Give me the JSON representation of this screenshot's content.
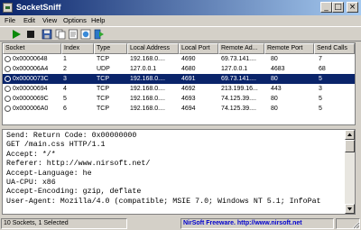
{
  "window": {
    "title": "SocketSniff",
    "minimize_glyph": "_",
    "maximize_glyph": "□",
    "close_glyph": "×"
  },
  "menu": [
    "File",
    "Edit",
    "View",
    "Options",
    "Help"
  ],
  "toolbar": {
    "icons": [
      "play-icon",
      "stop-icon",
      "save-icon",
      "copy-icon",
      "properties-icon",
      "html-report-icon",
      "exit-icon"
    ],
    "colors": {
      "play": "#0a8a0a",
      "stop": "#1a1a1a"
    }
  },
  "table": {
    "columns": [
      "Socket",
      "Index",
      "Type",
      "Local Address",
      "Local Port",
      "Remote Ad...",
      "Remote Port",
      "Send Calls"
    ],
    "rows": [
      [
        "0x00000648",
        "1",
        "TCP",
        "192.168.0....",
        "4690",
        "69.73.141....",
        "80",
        "7"
      ],
      [
        "0x000006A4",
        "2",
        "UDP",
        "127.0.0.1",
        "4680",
        "127.0.0.1",
        "4683",
        "68"
      ],
      [
        "0x0000073C",
        "3",
        "TCP",
        "192.168.0....",
        "4691",
        "69.73.141....",
        "80",
        "5"
      ],
      [
        "0x00000694",
        "4",
        "TCP",
        "192.168.0....",
        "4692",
        "213.199.16...",
        "443",
        "3"
      ],
      [
        "0x0000069C",
        "5",
        "TCP",
        "192.168.0....",
        "4693",
        "74.125.39....",
        "80",
        "5"
      ],
      [
        "0x000006A0",
        "6",
        "TCP",
        "192.168.0....",
        "4694",
        "74.125.39....",
        "80",
        "5"
      ]
    ],
    "selected_index": 2,
    "selection_color": "#0a246a"
  },
  "detail": {
    "lines": [
      "Send: Return Code: 0x00000000",
      "GET /main.css HTTP/1.1",
      "Accept: */*",
      "Referer: http://www.nirsoft.net/",
      "Accept-Language: he",
      "UA-CPU: x86",
      "Accept-Encoding: gzip, deflate",
      "User-Agent: Mozilla/4.0 (compatible; MSIE 7.0; Windows NT 5.1; InfoPat"
    ]
  },
  "status": {
    "summary": "10 Sockets, 1 Selected",
    "link": "NirSoft Freeware.  http://www.nirsoft.net"
  }
}
